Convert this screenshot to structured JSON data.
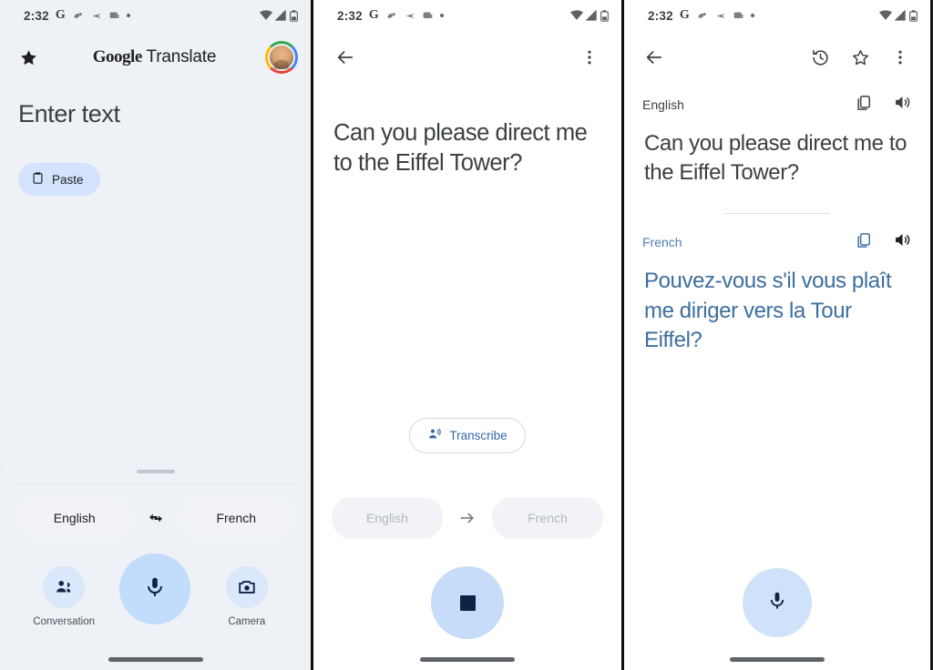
{
  "status_bar": {
    "time": "2:32",
    "left_icons": [
      "google-g-icon",
      "app-icon",
      "send-icon",
      "chat-icon",
      "dot-icon"
    ],
    "right_icons": [
      "wifi-icon",
      "signal-icon",
      "battery-icon"
    ]
  },
  "panel_home": {
    "app_title_bold": "Google",
    "app_title_light": " Translate",
    "star_icon": "star-filled-icon",
    "avatar": "user-avatar",
    "input_placeholder": "Enter text",
    "paste_label": "Paste",
    "paste_icon": "clipboard-icon",
    "source_language": "English",
    "target_language": "French",
    "swap_icon": "swap-horizontal-icon",
    "actions": [
      {
        "label": "Conversation",
        "icon": "conversation-icon"
      },
      {
        "label": "Camera",
        "icon": "camera-icon"
      }
    ],
    "mic_icon": "microphone-icon"
  },
  "panel_listening": {
    "back_icon": "back-arrow-icon",
    "overflow_icon": "more-vertical-icon",
    "recognized_text": "Can you please direct me to the Eiffel Tower?",
    "transcribe_label": "Transcribe",
    "transcribe_icon": "transcribe-person-icon",
    "source_language": "English",
    "target_language": "French",
    "arrow_icon": "arrow-right-icon",
    "stop_icon": "stop-square-icon"
  },
  "panel_result": {
    "back_icon": "back-arrow-icon",
    "history_icon": "history-icon",
    "star_icon": "star-outline-icon",
    "overflow_icon": "more-vertical-icon",
    "source_language": "English",
    "source_copy_icon": "copy-icon",
    "source_speak_icon": "volume-icon",
    "source_text": "Can you please direct me to the Eiffel Tower?",
    "target_language": "French",
    "target_copy_icon": "copy-icon",
    "target_speak_icon": "volume-icon",
    "target_text": "Pouvez-vous s'il vous plaît me diriger vers la Tour Eiffel?",
    "mic_icon": "microphone-icon"
  },
  "colors": {
    "accent_blue": "#4285f4",
    "chip_blue": "#d3e3fd",
    "fab_blue": "#c2dcfb",
    "translation_text": "#3d6f9e",
    "panel_bg_gray": "#eef1f5"
  }
}
